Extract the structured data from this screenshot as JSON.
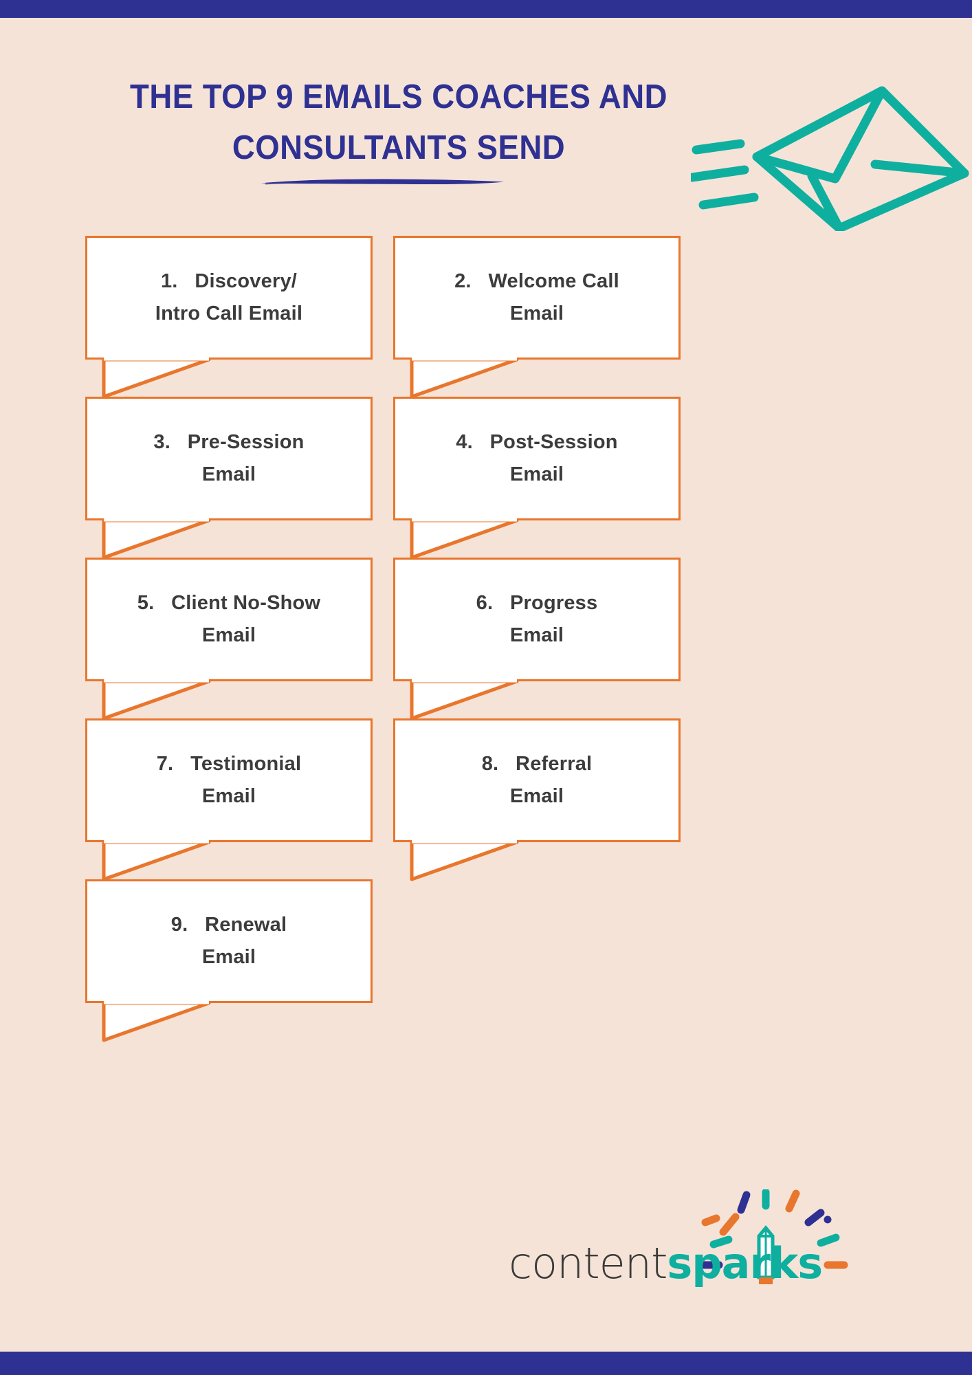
{
  "page": {
    "background_color": "#F6E3D8",
    "bar_color": "#2E3192",
    "box_border_color": "#E8762C",
    "accent_teal": "#0FAFA0",
    "text_color": "#3C3C3C"
  },
  "header": {
    "title_line1": "THE TOP 9 EMAILS COACHES AND",
    "title_line2": "CONSULTANTS SEND",
    "underline_name": "brush-underline",
    "icon_name": "envelope-icon",
    "icon_color": "#0FAFA0"
  },
  "items": [
    {
      "number": "1.",
      "label": "Discovery/\nIntro Call Email",
      "column": "left",
      "row": 1
    },
    {
      "number": "2.",
      "label": "Welcome Call\nEmail",
      "column": "right",
      "row": 1
    },
    {
      "number": "3.",
      "label": "Pre-Session\nEmail",
      "column": "left",
      "row": 2
    },
    {
      "number": "4.",
      "label": "Post-Session\nEmail",
      "column": "right",
      "row": 2
    },
    {
      "number": "5.",
      "label": "Client No-Show\nEmail",
      "column": "left",
      "row": 3
    },
    {
      "number": "6.",
      "label": "Progress\nEmail",
      "column": "right",
      "row": 3
    },
    {
      "number": "7.",
      "label": "Testimonial\nEmail",
      "column": "left",
      "row": 4
    },
    {
      "number": "8.",
      "label": "Referral\nEmail",
      "column": "right",
      "row": 4
    },
    {
      "number": "9.",
      "label": "Renewal\nEmail",
      "column": "left",
      "row": 5
    }
  ],
  "logo": {
    "part1": "content",
    "part2": "sparks",
    "part1_color": "#3A3A38",
    "part2_color": "#0FAFA0",
    "burst_name": "spark-burst-icon",
    "pencil_name": "pencil-icon"
  }
}
